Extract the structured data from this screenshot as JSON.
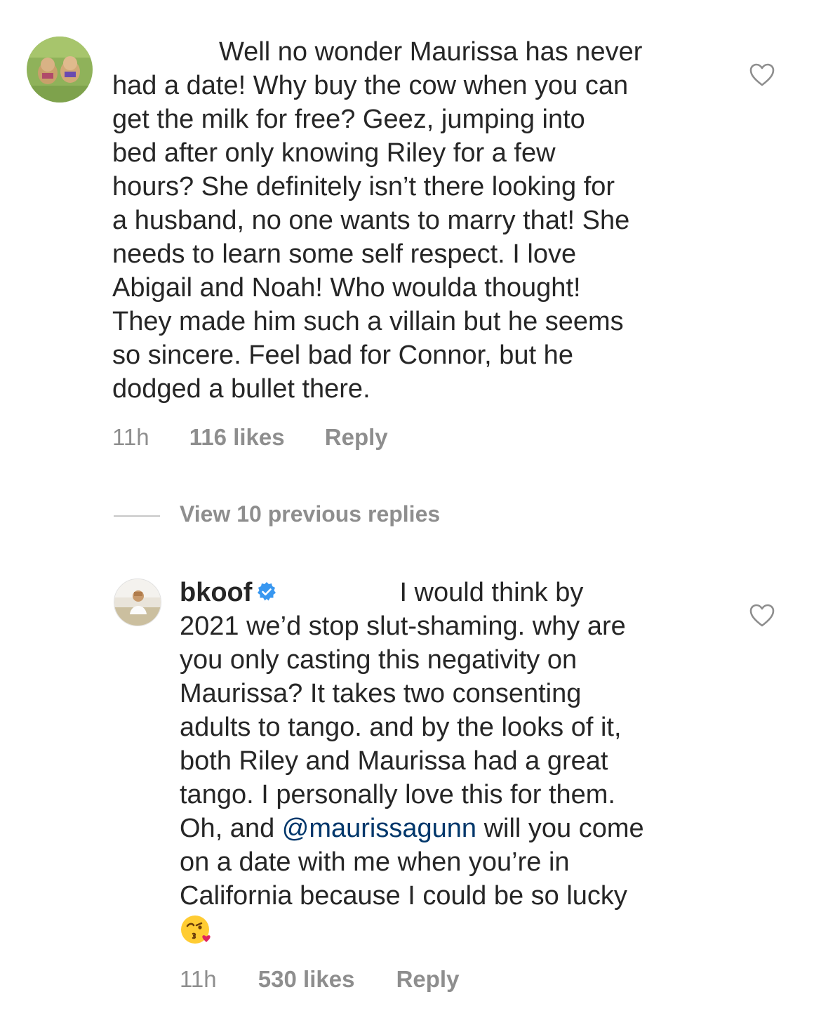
{
  "colors": {
    "text": "#262626",
    "muted": "#8e8e8e",
    "mention": "#00376b",
    "verified": "#3897f0"
  },
  "comments": [
    {
      "avatar_icon": "dogs-avatar",
      "lines": [
        "Well no wonder Maurissa has never",
        "had a date! Why buy the cow when you can",
        "get the milk for free? Geez, jumping into",
        "bed after only knowing Riley for a few",
        "hours? She definitely isn’t there looking for",
        "a husband, no one wants to marry that! She",
        "needs to learn some self respect. I love",
        "Abigail and Noah! Who woulda thought!",
        "They made him such a villain but he seems",
        "so sincere. Feel bad for Connor, but he",
        "dodged a bullet there."
      ],
      "time": "11h",
      "likes": "116 likes",
      "reply": "Reply",
      "like_icon": "heart-outline-icon"
    }
  ],
  "view_replies": "View 10 previous replies",
  "reply_comment": {
    "avatar_icon": "woman-avatar",
    "username": "bkoof",
    "verified_icon": "verified-badge-icon",
    "first_line_rest": "I would think by",
    "lines": [
      "2021 we’d stop slut-shaming. why are",
      "you only casting this negativity on",
      "Maurissa? It takes two consenting",
      "adults to tango. and by the looks of it,",
      "both Riley and Maurissa had a great",
      "tango. I personally love this for them."
    ],
    "mention_line_before": "Oh, and ",
    "mention": "@maurissagunn",
    "mention_line_after": " will you come",
    "lines_after": [
      "on a date with me when you’re in",
      "California because I could be so lucky"
    ],
    "emoji_icon": "kissing-wink-emoji",
    "time": "11h",
    "likes": "530 likes",
    "reply": "Reply",
    "like_icon": "heart-outline-icon"
  }
}
